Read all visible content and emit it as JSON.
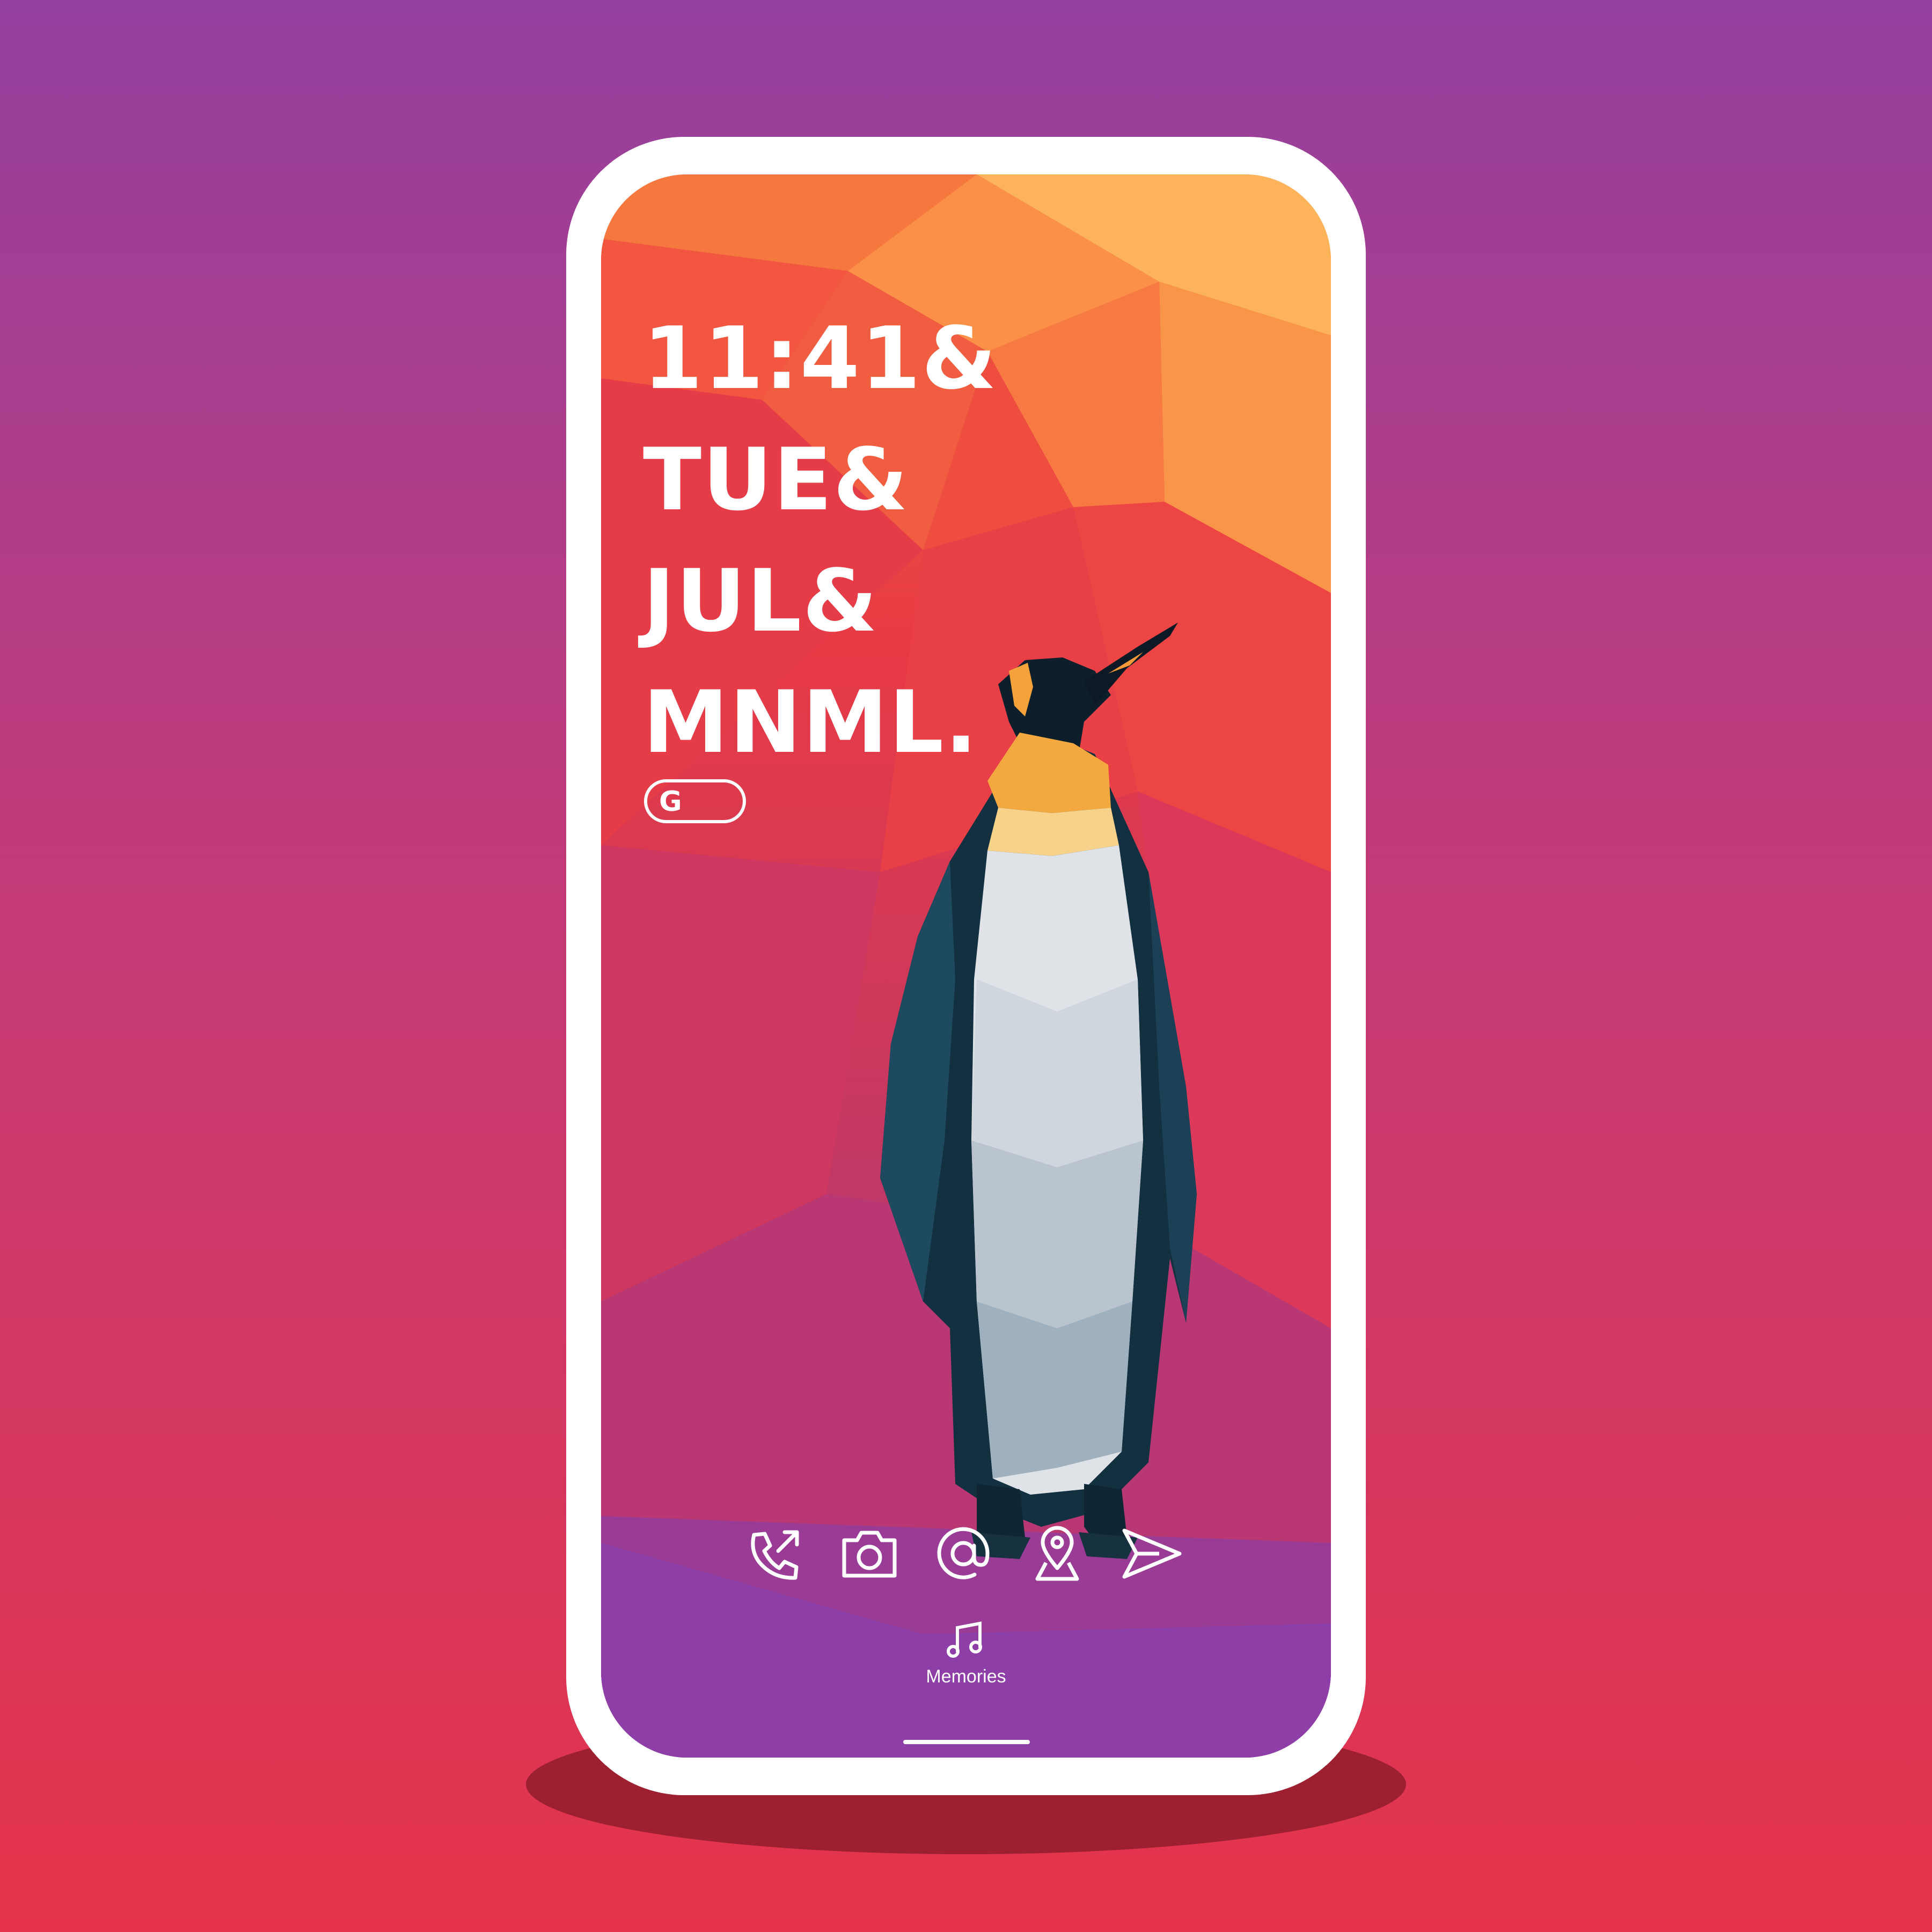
{
  "clock_widget": {
    "lines": [
      "11:41&",
      "TUE&",
      "JUL&",
      "MNML."
    ]
  },
  "search": {
    "logo_letter": "G"
  },
  "dock": {
    "icons": [
      "phone-icon",
      "camera-icon",
      "at-icon",
      "map-pin-icon",
      "send-icon"
    ]
  },
  "memories": {
    "label": "Memories",
    "icon": "music-note-icon"
  },
  "colors": {
    "bg_top": "#94409f",
    "bg_bottom": "#e5344a",
    "screen_top": "#f26a3c",
    "screen_bottom": "#8e3ea6",
    "foreground": "#ffffff"
  }
}
